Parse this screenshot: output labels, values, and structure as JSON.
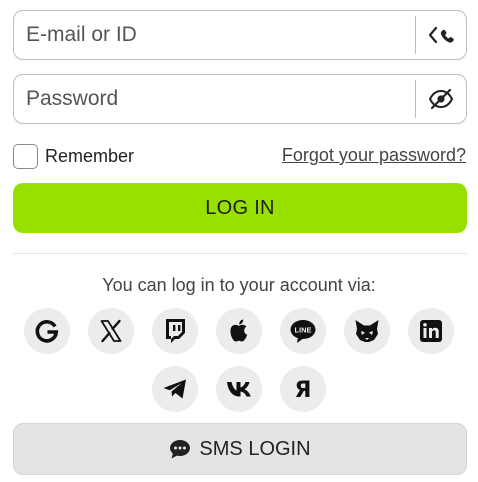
{
  "login_form": {
    "email_placeholder": "E-mail or ID",
    "password_placeholder": "Password",
    "remember_label": "Remember",
    "forgot_link": "Forgot your password?",
    "login_button": "LOG IN"
  },
  "social": {
    "heading": "You can log in to your account via:",
    "providers": [
      "google",
      "x",
      "twitch",
      "apple",
      "line",
      "metamask",
      "linkedin",
      "telegram",
      "vk",
      "yandex"
    ]
  },
  "sms": {
    "button_label": "SMS LOGIN",
    "icon": "chat-bubble-icon"
  },
  "colors": {
    "accent": "#98e000",
    "sms_button": "#e4e4e4",
    "social_bg": "#ececec"
  }
}
